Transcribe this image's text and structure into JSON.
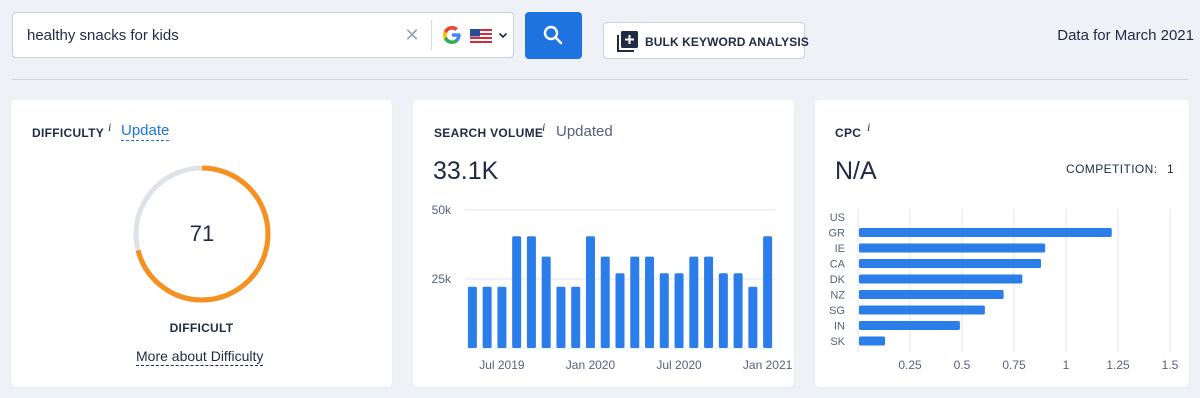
{
  "search": {
    "query": "healthy snacks for kids",
    "clear_icon": "close-icon",
    "engine_icon": "google-icon",
    "database_flag": "us-flag-icon",
    "dropdown_icon": "chevron-down-icon",
    "search_icon": "search-icon",
    "accent_color": "#1e73e0"
  },
  "toolbar": {
    "bulk_label": "BULK KEYWORD ANALYSIS",
    "bulk_icon": "plus-square-icon"
  },
  "header": {
    "data_date": "Data for March 2021"
  },
  "difficulty": {
    "title": "DIFFICULTY",
    "info": "i",
    "update_link": "Update",
    "value": "71",
    "score": 71,
    "max": 100,
    "status": "DIFFICULT",
    "more_link": "More about Difficulty",
    "gauge_color": "#f7901e",
    "track_color": "#dfe2e8"
  },
  "search_volume": {
    "title": "SEARCH VOLUME",
    "info": "i",
    "status": "Updated",
    "value": "33.1K"
  },
  "cpc": {
    "title": "CPC",
    "info": "i",
    "value": "N/A",
    "competition_label": "COMPETITION:",
    "competition_value": "1"
  },
  "chart_data": [
    {
      "type": "bar",
      "name": "search-volume-trend",
      "x_tick_labels": [
        "Jul 2019",
        "Jan 2020",
        "Jul 2020",
        "Jan 2021"
      ],
      "y_tick_labels": [
        "50k",
        "25k"
      ],
      "ylim": [
        0,
        50000
      ],
      "values": [
        22200,
        22200,
        22200,
        40500,
        40500,
        33100,
        22200,
        22200,
        40500,
        33100,
        27100,
        33100,
        33100,
        27100,
        27100,
        33100,
        33100,
        27100,
        27100,
        22200,
        40500
      ],
      "grid": true,
      "bar_color": "#2b7de9"
    },
    {
      "type": "bar",
      "orientation": "horizontal",
      "name": "cpc-by-country",
      "categories": [
        "US",
        "GR",
        "IE",
        "CA",
        "DK",
        "NZ",
        "SG",
        "IN",
        "SK"
      ],
      "values": [
        0,
        1.22,
        0.9,
        0.88,
        0.79,
        0.7,
        0.61,
        0.49,
        0.13
      ],
      "x_tick_labels": [
        "0.25",
        "0.5",
        "0.75",
        "1",
        "1.25",
        "1.5"
      ],
      "xlim": [
        0,
        1.5
      ],
      "grid": true,
      "bar_color": "#2b7de9"
    }
  ]
}
